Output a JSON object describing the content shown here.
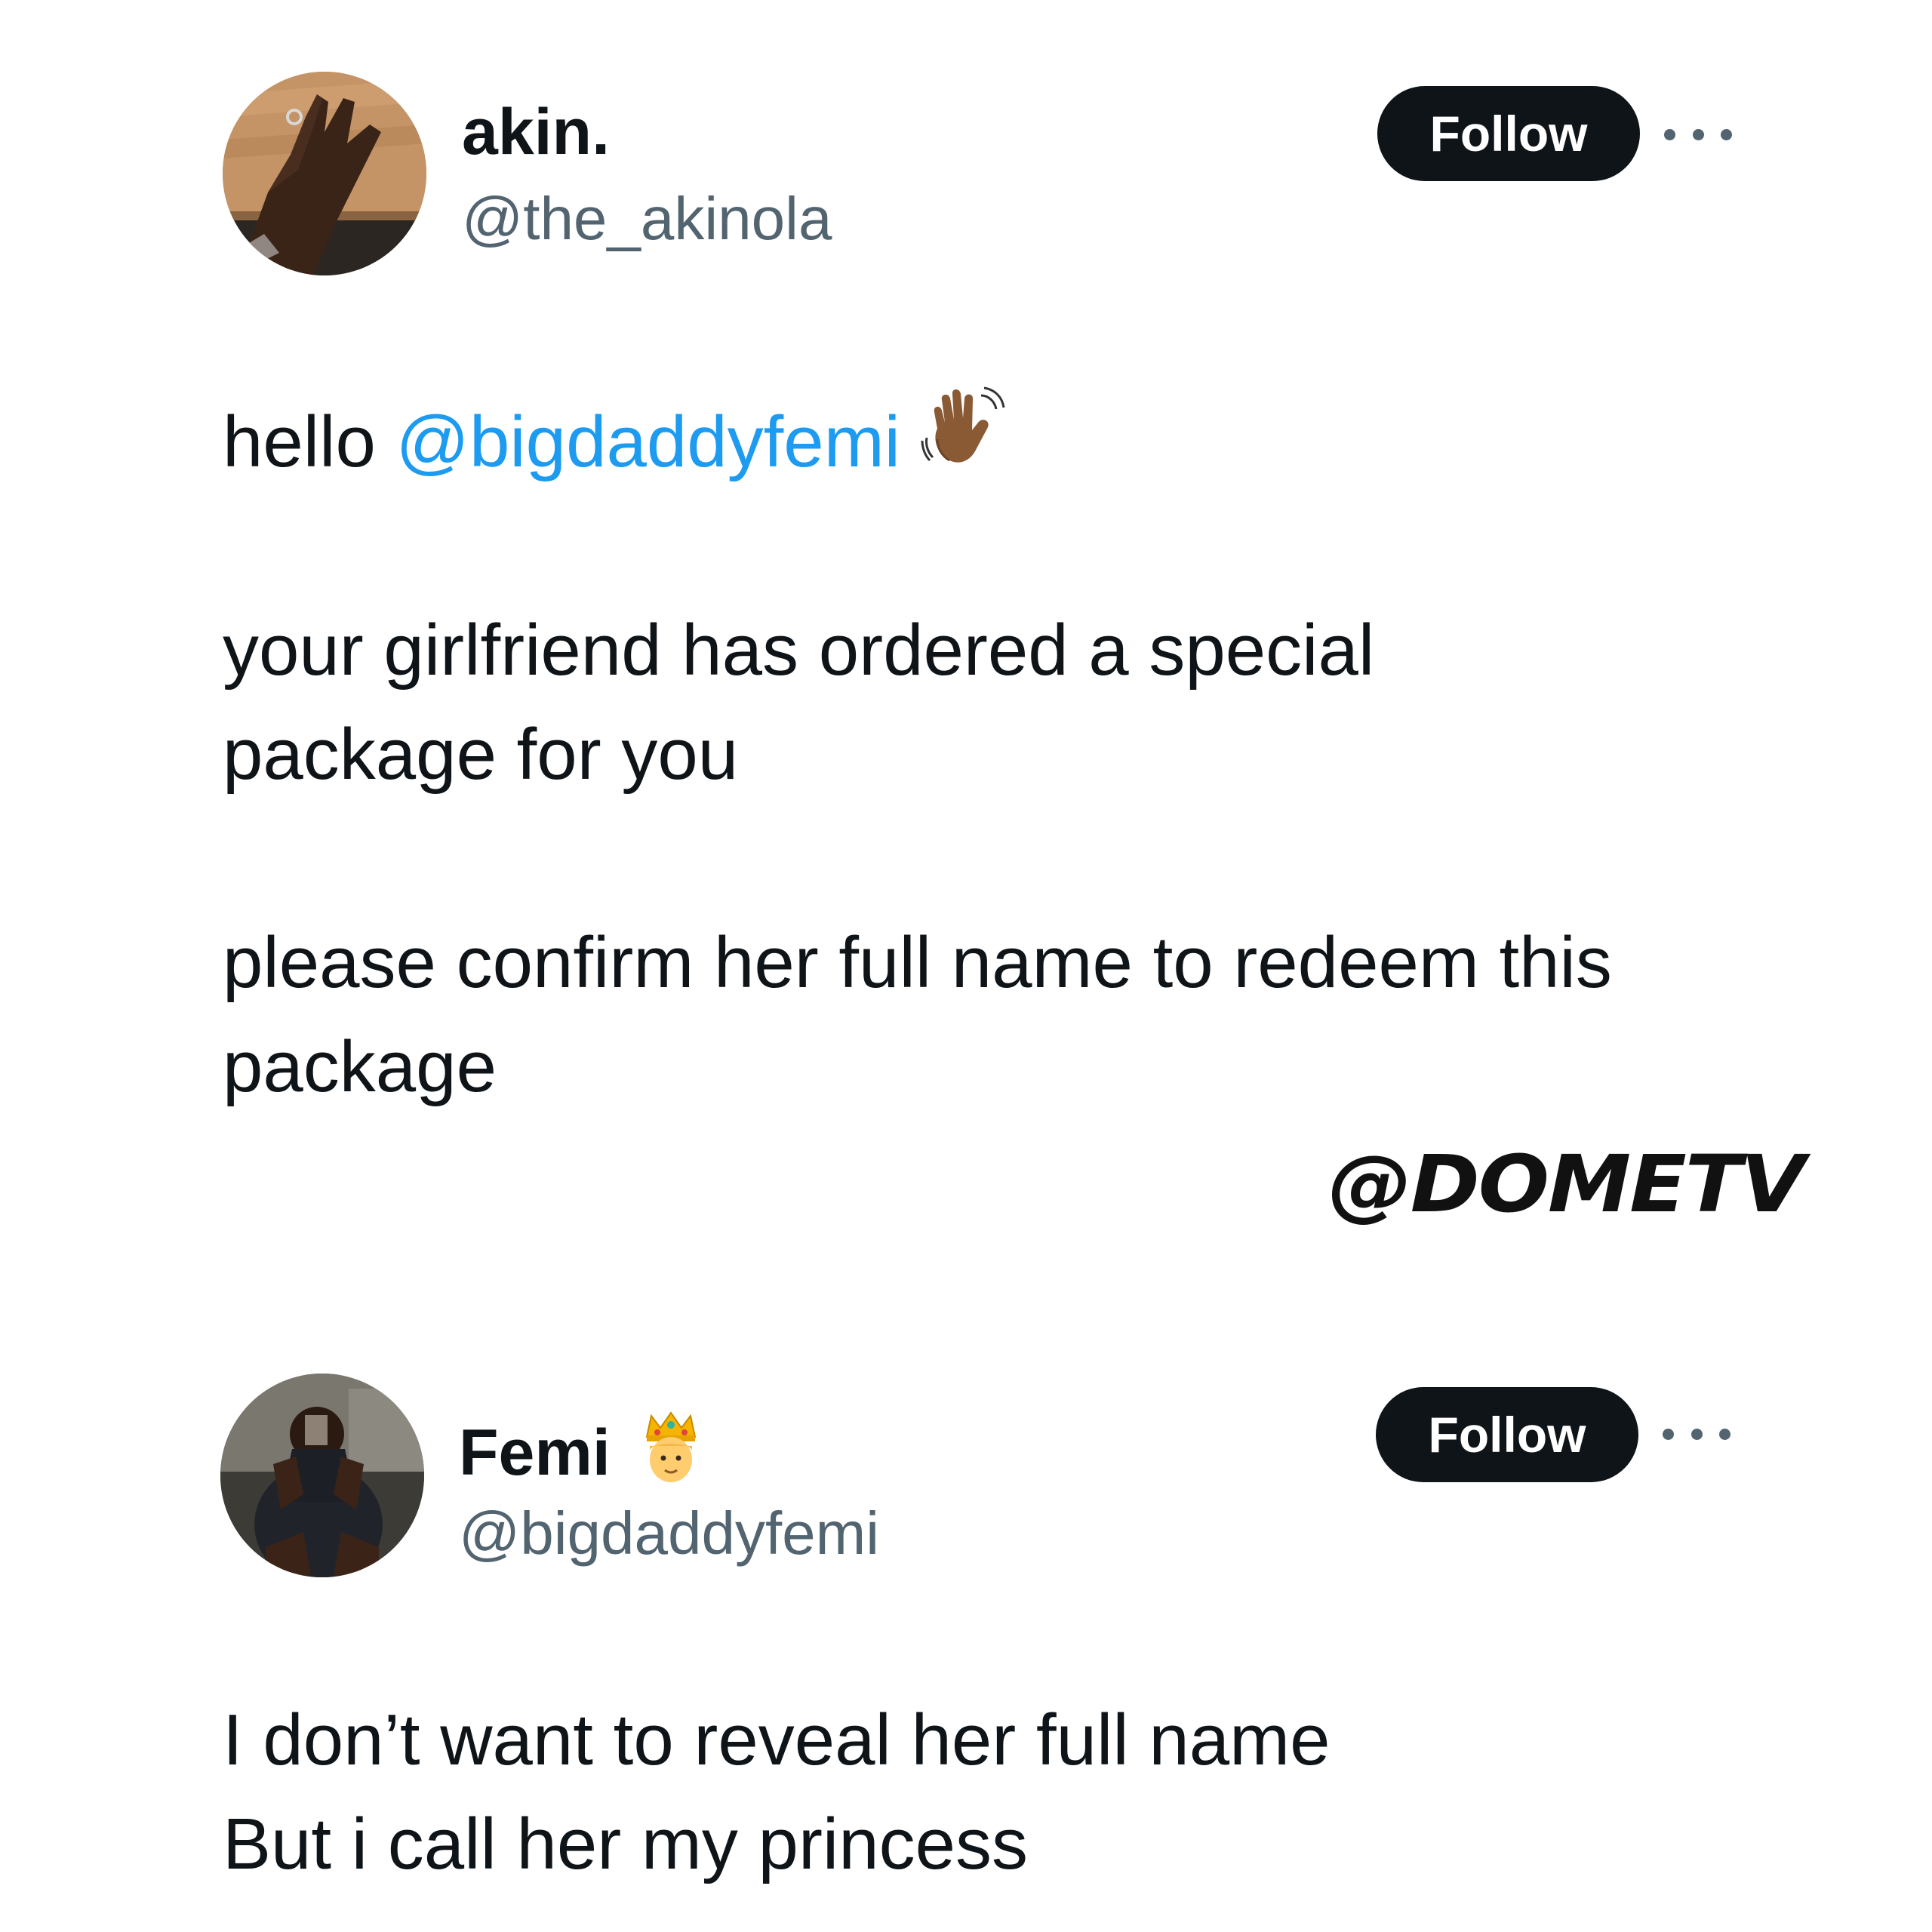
{
  "tweets": [
    {
      "display_name": "akin.",
      "handle": "@the_akinola",
      "follow_label": "Follow",
      "avatar_icon": "hand-on-table-photo",
      "body": {
        "greeting_prefix": "hello ",
        "mention": "@bigdaddyfemi",
        "greeting_emoji": "waving-hand-emoji",
        "paragraph_2": "your girlfriend has ordered a special package for you",
        "paragraph_3": "please confirm her full name to redeem this package"
      }
    },
    {
      "display_name": "Femi",
      "name_emoji": "prince-emoji",
      "handle": "@bigdaddyfemi",
      "follow_label": "Follow",
      "avatar_icon": "man-sitting-photo",
      "body": {
        "line_1": "I don’t want to reveal her full name",
        "line_2": "But i call her my princess"
      }
    }
  ],
  "watermark": "@DOMETV",
  "colors": {
    "text": "#0f1419",
    "secondary": "#536471",
    "link": "#1d9bf0",
    "button_bg": "#0f1419",
    "button_text": "#ffffff",
    "background": "#ffffff"
  }
}
